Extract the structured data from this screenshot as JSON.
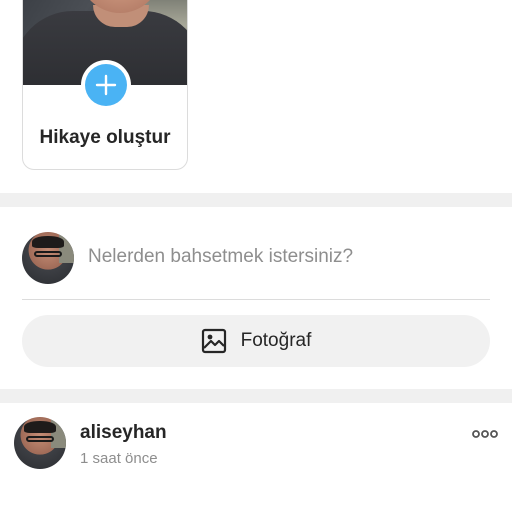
{
  "story": {
    "create_label": "Hikaye oluştur"
  },
  "composer": {
    "placeholder": "Nelerden bahsetmek istersiniz?",
    "photo_label": "Fotoğraf"
  },
  "post": {
    "username": "aliseyhan",
    "time": "1 saat önce"
  },
  "icons": {
    "add": "plus-icon",
    "photo": "image-icon",
    "more": "more-horizontal-icon"
  },
  "colors": {
    "accent": "#4ab3f4",
    "text": "#262626",
    "muted": "#8e8e8e",
    "divider": "#f0f0f0",
    "button_bg": "#f1f1f1"
  }
}
